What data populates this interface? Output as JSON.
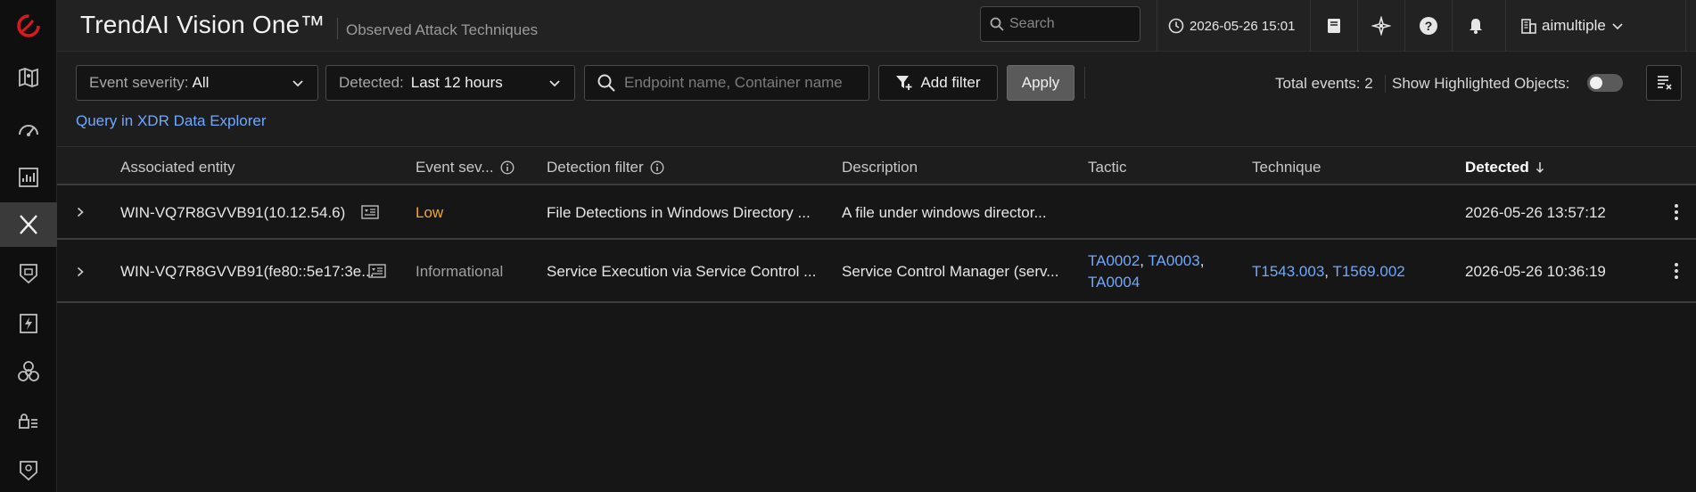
{
  "header": {
    "app_title": "TrendAI Vision One™",
    "page_subtitle": "Observed Attack Techniques",
    "search_placeholder": "Search",
    "datetime": "2026-05-26 15:01",
    "account_name": "aimultiple"
  },
  "toolbar": {
    "severity_label": "Event severity:",
    "severity_value": "All",
    "detected_label": "Detected:",
    "detected_value": "Last 12 hours",
    "filter_placeholder": "Endpoint name, Container name",
    "add_filter_label": "Add filter",
    "apply_label": "Apply",
    "total_events_label": "Total events:",
    "total_events_value": "2",
    "show_highlighted_label": "Show Highlighted Objects:",
    "show_highlighted_on": false,
    "query_link": "Query in XDR Data Explorer"
  },
  "table": {
    "columns": {
      "entity": "Associated entity",
      "severity": "Event sev...",
      "filter": "Detection filter",
      "description": "Description",
      "tactic": "Tactic",
      "technique": "Technique",
      "detected": "Detected"
    },
    "rows": [
      {
        "entity": "WIN-VQ7R8GVVB91(10.12.54.6)",
        "severity": "Low",
        "filter": "File Detections in Windows Directory ...",
        "description": "A file under windows director...",
        "tactics": [],
        "techniques": [],
        "detected": "2026-05-26 13:57:12"
      },
      {
        "entity": "WIN-VQ7R8GVVB91(fe80::5e17:3e...",
        "severity": "Informational",
        "filter": "Service Execution via Service Control ...",
        "description": "Service Control Manager (serv...",
        "tactics": [
          "TA0002",
          "TA0003",
          "TA0004"
        ],
        "techniques": [
          "T1543.003",
          "T1569.002"
        ],
        "detected": "2026-05-26 10:36:19"
      }
    ]
  },
  "colors": {
    "accent_link": "#6fa8ff",
    "severity_low": "#f5a623",
    "brand_red": "#d71920"
  }
}
